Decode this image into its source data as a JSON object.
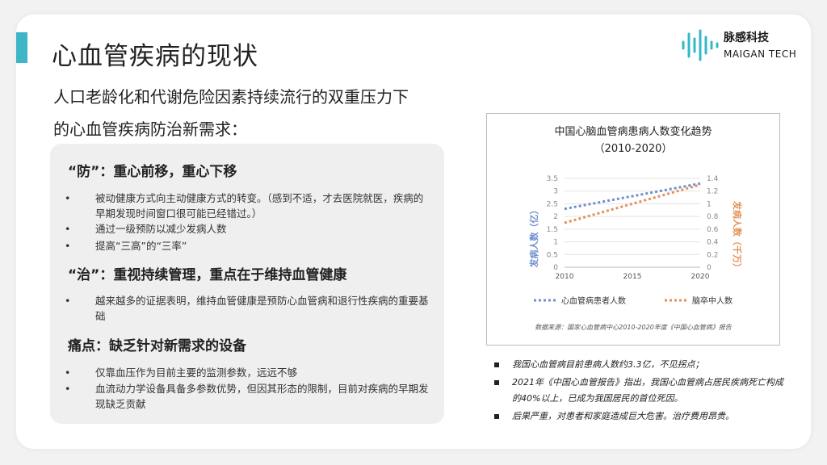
{
  "slide": {
    "title": "心血管疾病的现状",
    "logo": {
      "cn": "脉感科技",
      "en": "MAIGAN TECH"
    },
    "subtitle_line1": "人口老龄化和代谢危险因素持续流行的双重压力下",
    "subtitle_line2": "的心血管疾病防治新需求："
  },
  "sections": [
    {
      "heading": "“防”：重心前移，重心下移",
      "bullets": [
        "被动健康方式向主动健康方式的转变。（感到不适，才去医院就医，疾病的早期发现时间窗口很可能已经错过。）",
        "通过一级预防以减少发病人数",
        "提高“三高”的“三率”"
      ]
    },
    {
      "heading": "“治”：重视持续管理，重点在于维持血管健康",
      "bullets": [
        "越来越多的证据表明，维持血管健康是预防心血管病和退行性疾病的重要基础"
      ]
    },
    {
      "heading": "痛点：缺乏针对新需求的设备",
      "bullets": [
        "仅靠血压作为目前主要的监测参数，远远不够",
        "血流动力学设备具备多参数优势，但因其形态的限制，目前对疾病的早期发现缺乏贡献"
      ]
    }
  ],
  "bullet_symbol": "•",
  "chart_data": {
    "type": "line",
    "title": "中国心脑血管病患病人数变化趋势",
    "subtitle": "（2010-2020）",
    "x": [
      2010,
      2020
    ],
    "x_ticks": [
      "2010",
      "2015",
      "2020"
    ],
    "ylabel": "发病人数（亿）",
    "y2label": "发病人数（千万）",
    "ylim": [
      0,
      3.5
    ],
    "y2lim": [
      0,
      1.4
    ],
    "y_ticks": [
      "0",
      "0.5",
      "1",
      "1.5",
      "2",
      "2.5",
      "3",
      "3.5"
    ],
    "y2_ticks": [
      "0",
      "0.2",
      "0.4",
      "0.6",
      "0.8",
      "1",
      "1.2",
      "1.4"
    ],
    "series": [
      {
        "name": "心血管病患者人数",
        "axis": "left",
        "color": "#6f8fd0",
        "x": [
          2010,
          2020
        ],
        "values": [
          2.3,
          3.3
        ]
      },
      {
        "name": "脑卒中人数",
        "axis": "right",
        "color": "#e3915a",
        "x": [
          2010,
          2020
        ],
        "values": [
          0.7,
          1.3
        ]
      }
    ],
    "source": "数据来源：国家心血管病中心2010-2020年度《中国心血管病》报告",
    "grid": true,
    "legend": "bottom"
  },
  "notes": [
    "我国心血管病目前患病人数约3.3亿，不见拐点；",
    "2021年《中国心血管报告》指出，我国心血管病占居民疾病死亡构成的40%以上，已成为我国居民的首位死因。",
    "后果严重，对患者和家庭造成巨大危害。治疗费用昂贵。"
  ],
  "colors": {
    "accent": "#3fb6c8",
    "panel": "#efefef"
  }
}
